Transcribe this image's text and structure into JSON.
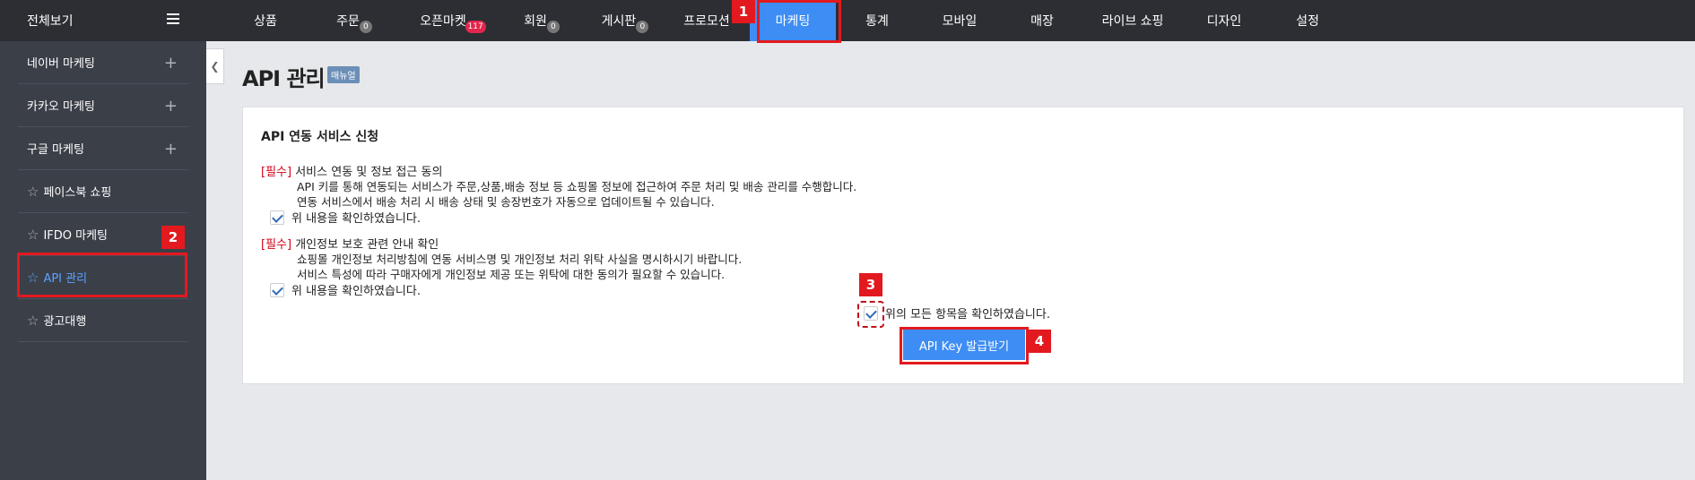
{
  "header": {
    "brand": "전체보기",
    "nav": [
      {
        "label": "상품",
        "badge": ""
      },
      {
        "label": "주문",
        "badge": "0"
      },
      {
        "label": "오픈마켓",
        "badge": "117"
      },
      {
        "label": "회원",
        "badge": "0"
      },
      {
        "label": "게시판",
        "badge": "0"
      },
      {
        "label": "프로모션",
        "badge": ""
      },
      {
        "label": "마케팅",
        "badge": ""
      },
      {
        "label": "통계",
        "badge": ""
      },
      {
        "label": "모바일",
        "badge": ""
      },
      {
        "label": "매장",
        "badge": ""
      },
      {
        "label": "라이브 쇼핑",
        "badge": ""
      },
      {
        "label": "디자인",
        "badge": ""
      },
      {
        "label": "설정",
        "badge": ""
      }
    ]
  },
  "sidebar": {
    "items": [
      {
        "label": "네이버 마케팅"
      },
      {
        "label": "카카오 마케팅"
      },
      {
        "label": "구글 마케팅"
      },
      {
        "label": "페이스북 쇼핑"
      },
      {
        "label": "IFDO 마케팅"
      },
      {
        "label": "API 관리"
      },
      {
        "label": "광고대행"
      }
    ]
  },
  "main": {
    "title": "API 관리",
    "manual_badge": "매뉴얼",
    "card": {
      "title": "API 연동 서비스 신청",
      "section1": {
        "required": "[필수]",
        "title": "서비스 연동 및 정보 접근 동의",
        "line1": "API 키를 통해 연동되는 서비스가 주문,상품,배송 정보 등 쇼핑몰 정보에 접근하여 주문 처리 및 배송 관리를 수행합니다.",
        "line2": "연동 서비스에서 배송 처리 시 배송 상태 및 송장번호가 자동으로 업데이트될 수 있습니다.",
        "confirm": "위 내용을 확인하였습니다."
      },
      "section2": {
        "required": "[필수]",
        "title": "개인정보 보호 관련 안내 확인",
        "line1": "쇼핑몰 개인정보 처리방침에 연동 서비스명 및 개인정보 처리 위탁 사실을 명시하시기 바랍니다.",
        "line2": "서비스 특성에 따라 구매자에게 개인정보 제공 또는 위탁에 대한 동의가 필요할 수 있습니다.",
        "confirm": "위 내용을 확인하였습니다."
      },
      "confirm_all": "위의 모든 항목을 확인하였습니다.",
      "issue_button": "API Key 발급받기"
    }
  },
  "annotations": {
    "n1": "1",
    "n2": "2",
    "n3": "3",
    "n4": "4"
  },
  "colors": {
    "accent": "#3d8df5",
    "annotation": "#e2191f",
    "sidebar": "#3b3f48",
    "topbar": "#2c2e33"
  }
}
